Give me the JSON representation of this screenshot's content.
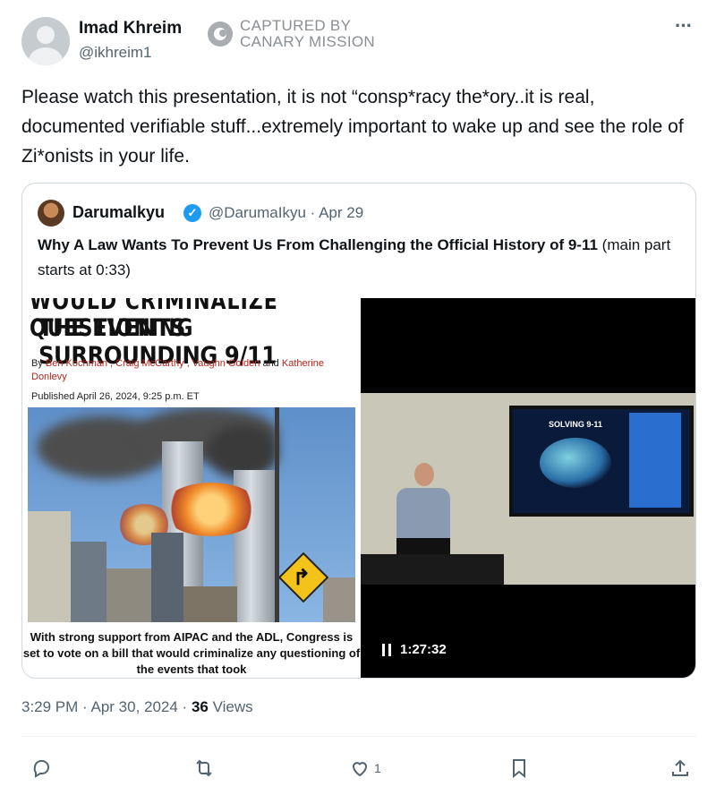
{
  "author": {
    "name": "Imad Khreim",
    "handle": "@ikhreim1"
  },
  "watermark": {
    "line1": "CAPTURED BY",
    "line2": "CANARY MISSION"
  },
  "more_label": "···",
  "tweet": {
    "text": "Please watch this presentation, it is not “consp*racy the*ory..it is real, documented verifiable stuff...extremely important to wake up and see the role of Zi*onists in your life."
  },
  "quoted": {
    "name": "Darumalkyu",
    "meta": "@DarumaIkyu · Apr 29",
    "title_bold": "Why A Law Wants To Prevent Us From Challenging the Official History of 9-11",
    "title_rest": " (main part starts at 0:33)",
    "article": {
      "kicker": "WOULD CRIMINALIZE QUESTIONING",
      "headline": "THE EVENTS SURROUNDING 9/11",
      "by_prefix": "By ",
      "authors": "Ben Kochman , Craig McCarthy , Vaughn Golden",
      "by_and": " and ",
      "author_last": "Katherine Donlevy",
      "published": "Published April 26, 2024, 9:25 p.m. ET",
      "caption": "With strong support from AIPAC and the ADL, Congress is set to vote on a bill that would criminalize any questioning of the events that took"
    },
    "video": {
      "slide_title": "SOLVING 9-11",
      "duration": "1:27:32"
    }
  },
  "footer": {
    "time": "3:29 PM · Apr 30, 2024 · ",
    "views_count": "36",
    "views_label": " Views"
  },
  "actions": {
    "like_count": "1"
  },
  "icons": [
    "reply-icon",
    "retweet-icon",
    "like-icon",
    "bookmark-icon",
    "share-icon",
    "verified-badge-icon",
    "pause-icon"
  ]
}
